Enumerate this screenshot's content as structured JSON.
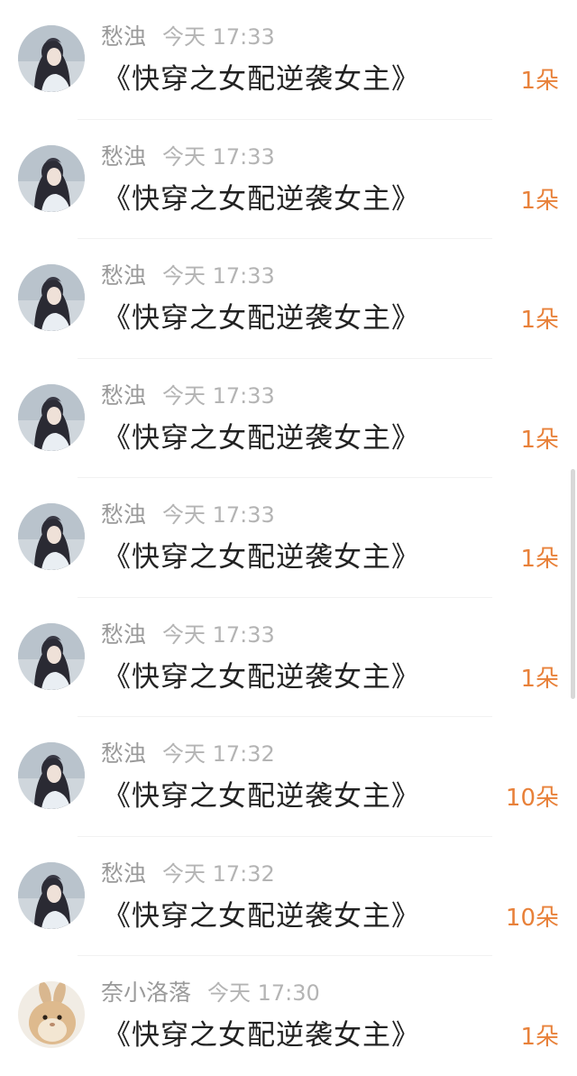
{
  "rows": [
    {
      "name": "愁浊",
      "time": "今天 17:33",
      "book": "《快穿之女配逆袭女主》",
      "gift": "1朵",
      "avatar": "girl-avatar"
    },
    {
      "name": "愁浊",
      "time": "今天 17:33",
      "book": "《快穿之女配逆袭女主》",
      "gift": "1朵",
      "avatar": "girl-avatar"
    },
    {
      "name": "愁浊",
      "time": "今天 17:33",
      "book": "《快穿之女配逆袭女主》",
      "gift": "1朵",
      "avatar": "girl-avatar"
    },
    {
      "name": "愁浊",
      "time": "今天 17:33",
      "book": "《快穿之女配逆袭女主》",
      "gift": "1朵",
      "avatar": "girl-avatar"
    },
    {
      "name": "愁浊",
      "time": "今天 17:33",
      "book": "《快穿之女配逆袭女主》",
      "gift": "1朵",
      "avatar": "girl-avatar"
    },
    {
      "name": "愁浊",
      "time": "今天 17:33",
      "book": "《快穿之女配逆袭女主》",
      "gift": "1朵",
      "avatar": "girl-avatar"
    },
    {
      "name": "愁浊",
      "time": "今天 17:32",
      "book": "《快穿之女配逆袭女主》",
      "gift": "10朵",
      "avatar": "girl-avatar"
    },
    {
      "name": "愁浊",
      "time": "今天 17:32",
      "book": "《快穿之女配逆袭女主》",
      "gift": "10朵",
      "avatar": "girl-avatar"
    },
    {
      "name": "奈小洛落",
      "time": "今天 17:30",
      "book": "《快穿之女配逆袭女主》",
      "gift": "1朵",
      "avatar": "bunny-avatar"
    }
  ],
  "colors": {
    "name": "#9a9a9a",
    "time": "#b4b4b4",
    "book": "#222222",
    "gift": "#e8813a",
    "divider": "#f2f2f2"
  }
}
